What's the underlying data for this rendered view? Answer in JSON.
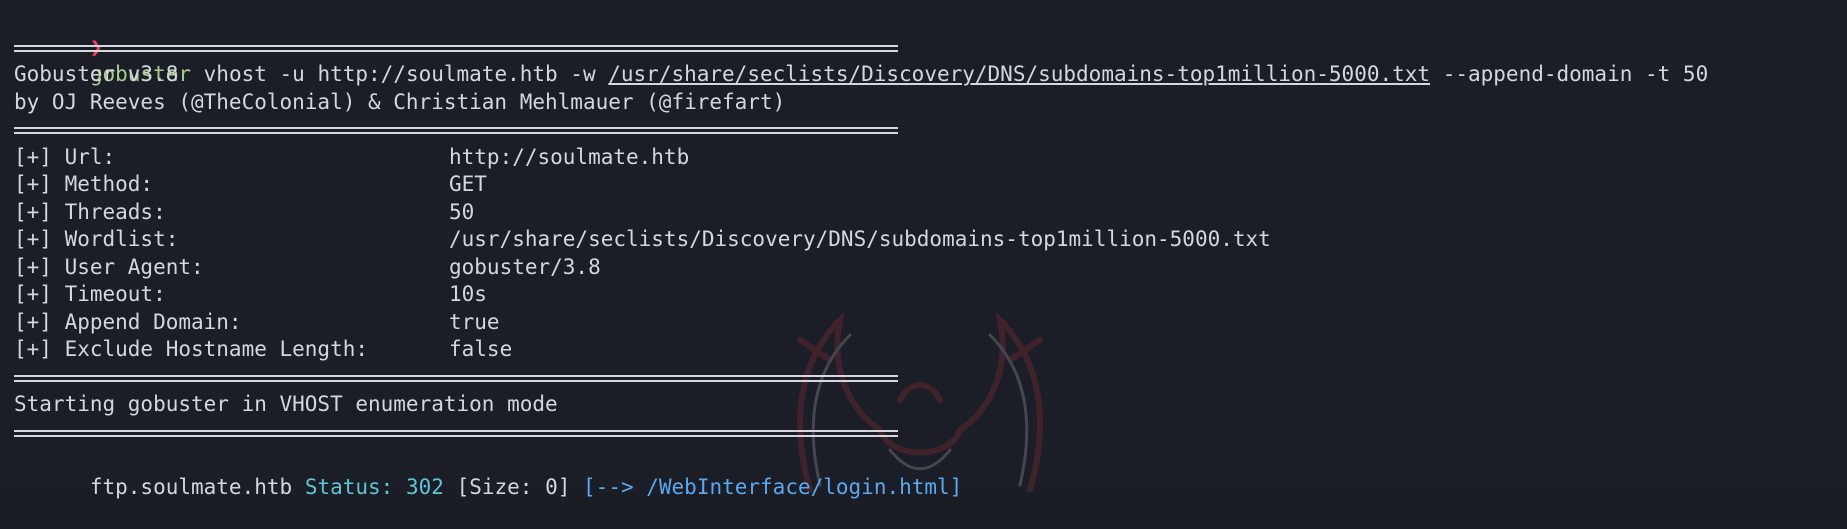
{
  "prompt": {
    "symbol": "❯",
    "command": "gobuster",
    "args_before": " vhost -u http://soulmate.htb -w ",
    "wordlist_path": "/usr/share/seclists/Discovery/DNS/subdomains-top1million-5000.txt",
    "args_after": " --append-domain -t 50"
  },
  "banner": {
    "version": "Gobuster v3.8",
    "authors": "by OJ Reeves (@TheColonial) & Christian Mehlmauer (@firefart)"
  },
  "config": [
    {
      "key": "[+] Url:",
      "value": "http://soulmate.htb"
    },
    {
      "key": "[+] Method:",
      "value": "GET"
    },
    {
      "key": "[+] Threads:",
      "value": "50"
    },
    {
      "key": "[+] Wordlist:",
      "value": "/usr/share/seclists/Discovery/DNS/subdomains-top1million-5000.txt"
    },
    {
      "key": "[+] User Agent:",
      "value": "gobuster/3.8"
    },
    {
      "key": "[+] Timeout:",
      "value": "10s"
    },
    {
      "key": "[+] Append Domain:",
      "value": "true"
    },
    {
      "key": "[+] Exclude Hostname Length:",
      "value": "false"
    }
  ],
  "start_message": "Starting gobuster in VHOST enumeration mode",
  "result": {
    "host": "ftp.soulmate.htb",
    "status_label": "Status:",
    "status_code": "302",
    "size": "[Size: 0]",
    "redirect": "[--> /WebInterface/login.html]"
  },
  "colors": {
    "background": "#1b1e26",
    "text": "#d4d7dd",
    "prompt": "#f0445a",
    "command": "#a8d08d",
    "status": "#5ec4d6",
    "redirect": "#5aa8f0"
  }
}
